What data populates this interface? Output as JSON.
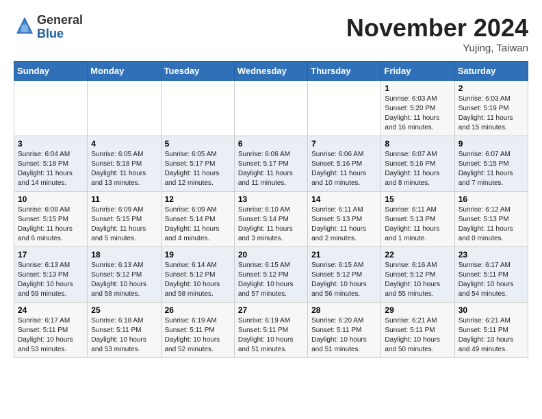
{
  "header": {
    "logo_line1": "General",
    "logo_line2": "Blue",
    "month_title": "November 2024",
    "location": "Yujing, Taiwan"
  },
  "days_of_week": [
    "Sunday",
    "Monday",
    "Tuesday",
    "Wednesday",
    "Thursday",
    "Friday",
    "Saturday"
  ],
  "weeks": [
    [
      {
        "day": "",
        "info": ""
      },
      {
        "day": "",
        "info": ""
      },
      {
        "day": "",
        "info": ""
      },
      {
        "day": "",
        "info": ""
      },
      {
        "day": "",
        "info": ""
      },
      {
        "day": "1",
        "info": "Sunrise: 6:03 AM\nSunset: 5:20 PM\nDaylight: 11 hours and 16 minutes."
      },
      {
        "day": "2",
        "info": "Sunrise: 6:03 AM\nSunset: 5:19 PM\nDaylight: 11 hours and 15 minutes."
      }
    ],
    [
      {
        "day": "3",
        "info": "Sunrise: 6:04 AM\nSunset: 5:18 PM\nDaylight: 11 hours and 14 minutes."
      },
      {
        "day": "4",
        "info": "Sunrise: 6:05 AM\nSunset: 5:18 PM\nDaylight: 11 hours and 13 minutes."
      },
      {
        "day": "5",
        "info": "Sunrise: 6:05 AM\nSunset: 5:17 PM\nDaylight: 11 hours and 12 minutes."
      },
      {
        "day": "6",
        "info": "Sunrise: 6:06 AM\nSunset: 5:17 PM\nDaylight: 11 hours and 11 minutes."
      },
      {
        "day": "7",
        "info": "Sunrise: 6:06 AM\nSunset: 5:16 PM\nDaylight: 11 hours and 10 minutes."
      },
      {
        "day": "8",
        "info": "Sunrise: 6:07 AM\nSunset: 5:16 PM\nDaylight: 11 hours and 8 minutes."
      },
      {
        "day": "9",
        "info": "Sunrise: 6:07 AM\nSunset: 5:15 PM\nDaylight: 11 hours and 7 minutes."
      }
    ],
    [
      {
        "day": "10",
        "info": "Sunrise: 6:08 AM\nSunset: 5:15 PM\nDaylight: 11 hours and 6 minutes."
      },
      {
        "day": "11",
        "info": "Sunrise: 6:09 AM\nSunset: 5:15 PM\nDaylight: 11 hours and 5 minutes."
      },
      {
        "day": "12",
        "info": "Sunrise: 6:09 AM\nSunset: 5:14 PM\nDaylight: 11 hours and 4 minutes."
      },
      {
        "day": "13",
        "info": "Sunrise: 6:10 AM\nSunset: 5:14 PM\nDaylight: 11 hours and 3 minutes."
      },
      {
        "day": "14",
        "info": "Sunrise: 6:11 AM\nSunset: 5:13 PM\nDaylight: 11 hours and 2 minutes."
      },
      {
        "day": "15",
        "info": "Sunrise: 6:11 AM\nSunset: 5:13 PM\nDaylight: 11 hours and 1 minute."
      },
      {
        "day": "16",
        "info": "Sunrise: 6:12 AM\nSunset: 5:13 PM\nDaylight: 11 hours and 0 minutes."
      }
    ],
    [
      {
        "day": "17",
        "info": "Sunrise: 6:13 AM\nSunset: 5:13 PM\nDaylight: 10 hours and 59 minutes."
      },
      {
        "day": "18",
        "info": "Sunrise: 6:13 AM\nSunset: 5:12 PM\nDaylight: 10 hours and 58 minutes."
      },
      {
        "day": "19",
        "info": "Sunrise: 6:14 AM\nSunset: 5:12 PM\nDaylight: 10 hours and 58 minutes."
      },
      {
        "day": "20",
        "info": "Sunrise: 6:15 AM\nSunset: 5:12 PM\nDaylight: 10 hours and 57 minutes."
      },
      {
        "day": "21",
        "info": "Sunrise: 6:15 AM\nSunset: 5:12 PM\nDaylight: 10 hours and 56 minutes."
      },
      {
        "day": "22",
        "info": "Sunrise: 6:16 AM\nSunset: 5:12 PM\nDaylight: 10 hours and 55 minutes."
      },
      {
        "day": "23",
        "info": "Sunrise: 6:17 AM\nSunset: 5:11 PM\nDaylight: 10 hours and 54 minutes."
      }
    ],
    [
      {
        "day": "24",
        "info": "Sunrise: 6:17 AM\nSunset: 5:11 PM\nDaylight: 10 hours and 53 minutes."
      },
      {
        "day": "25",
        "info": "Sunrise: 6:18 AM\nSunset: 5:11 PM\nDaylight: 10 hours and 53 minutes."
      },
      {
        "day": "26",
        "info": "Sunrise: 6:19 AM\nSunset: 5:11 PM\nDaylight: 10 hours and 52 minutes."
      },
      {
        "day": "27",
        "info": "Sunrise: 6:19 AM\nSunset: 5:11 PM\nDaylight: 10 hours and 51 minutes."
      },
      {
        "day": "28",
        "info": "Sunrise: 6:20 AM\nSunset: 5:11 PM\nDaylight: 10 hours and 51 minutes."
      },
      {
        "day": "29",
        "info": "Sunrise: 6:21 AM\nSunset: 5:11 PM\nDaylight: 10 hours and 50 minutes."
      },
      {
        "day": "30",
        "info": "Sunrise: 6:21 AM\nSunset: 5:11 PM\nDaylight: 10 hours and 49 minutes."
      }
    ]
  ]
}
